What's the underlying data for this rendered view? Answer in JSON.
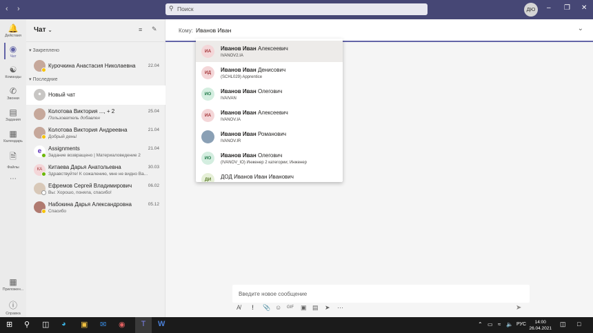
{
  "titlebar": {
    "search_placeholder": "Поиск",
    "user_initials": "ДЮ"
  },
  "rail": [
    {
      "label": "Действия",
      "icon": "bell-icon"
    },
    {
      "label": "Чат",
      "icon": "chat-icon"
    },
    {
      "label": "Команды",
      "icon": "teams-icon"
    },
    {
      "label": "Звонки",
      "icon": "phone-icon"
    },
    {
      "label": "Задания",
      "icon": "backpack-icon"
    },
    {
      "label": "Календарь",
      "icon": "calendar-icon"
    },
    {
      "label": "Файлы",
      "icon": "file-icon"
    },
    {
      "label": "Приложен...",
      "icon": "apps-icon"
    },
    {
      "label": "Справка",
      "icon": "help-icon"
    }
  ],
  "chatlist": {
    "title": "Чат",
    "pinned_label": "Закреплено",
    "recent_label": "Последние",
    "pinned": [
      {
        "name": "Курочкина Анастасия Николаевна",
        "date": "22.04"
      }
    ],
    "new_chat": "Новый чат",
    "recent": [
      {
        "name": "Колотова Виктория ..., + 2",
        "preview": "Пользователь добавлен",
        "date": "25.04"
      },
      {
        "name": "Колотова Виктория Андреевна",
        "preview": "Добрый день!",
        "date": "21.04"
      },
      {
        "name": "Assignments",
        "preview": "Задание возвращено | Материаловедение 2",
        "date": "21.04"
      },
      {
        "name": "Китаева Дарья Анатольевна",
        "preview": "Здравствуйте! К сожалению, мне не видно Ва...",
        "date": "30.03",
        "initials": "КА"
      },
      {
        "name": "Ефремов Сергей Владимирович",
        "preview": "Вы: Хорошо, поняла, спасибо!",
        "date": "06.02"
      },
      {
        "name": "Набокина Дарья Александровна",
        "preview": "Спасибо",
        "date": "05.12"
      }
    ]
  },
  "to": {
    "label": "Кому:",
    "value": "Иванов Иван"
  },
  "suggestions": [
    {
      "initials": "ИА",
      "bold": "Иванов Иван",
      "rest": " Алексеевич",
      "sub": "IVANOV2.IA",
      "color": "#f4d6d8",
      "fg": "#a4373a"
    },
    {
      "initials": "ИД",
      "bold": "Иванов Иван",
      "rest": " Денисович",
      "sub": "(SCHL029) Apprentice",
      "color": "#f4d6d8",
      "fg": "#a4373a"
    },
    {
      "initials": "ИО",
      "bold": "Иванов Иван",
      "rest": " Олегович",
      "sub": "IVAIVAN",
      "color": "#d4eee0",
      "fg": "#237b4b"
    },
    {
      "initials": "ИА",
      "bold": "Иванов Иван",
      "rest": " Алексеевич",
      "sub": "IVANOV.IA",
      "color": "#f4d6d8",
      "fg": "#a4373a"
    },
    {
      "initials": "",
      "bold": "Иванов Иван",
      "rest": " Романович",
      "sub": "IVANOV.IR",
      "color": "#8aa0b5",
      "fg": "#fff"
    },
    {
      "initials": "ИО",
      "bold": "Иванов Иван",
      "rest": " Олегович",
      "sub": "(IVANOV_IO) Инженер 2 категории; Инженер",
      "color": "#d4eee0",
      "fg": "#237b4b"
    },
    {
      "initials": "ДИ",
      "bold": "",
      "rest": "ДОД Иванов Иван Иванович",
      "sub": "",
      "color": "#e6f0d8",
      "fg": "#5a7a2a"
    }
  ],
  "compose": {
    "placeholder": "Введите новое сообщение"
  },
  "taskbar": {
    "lang": "РУС",
    "time": "14:00",
    "date": "26.04.2021"
  }
}
